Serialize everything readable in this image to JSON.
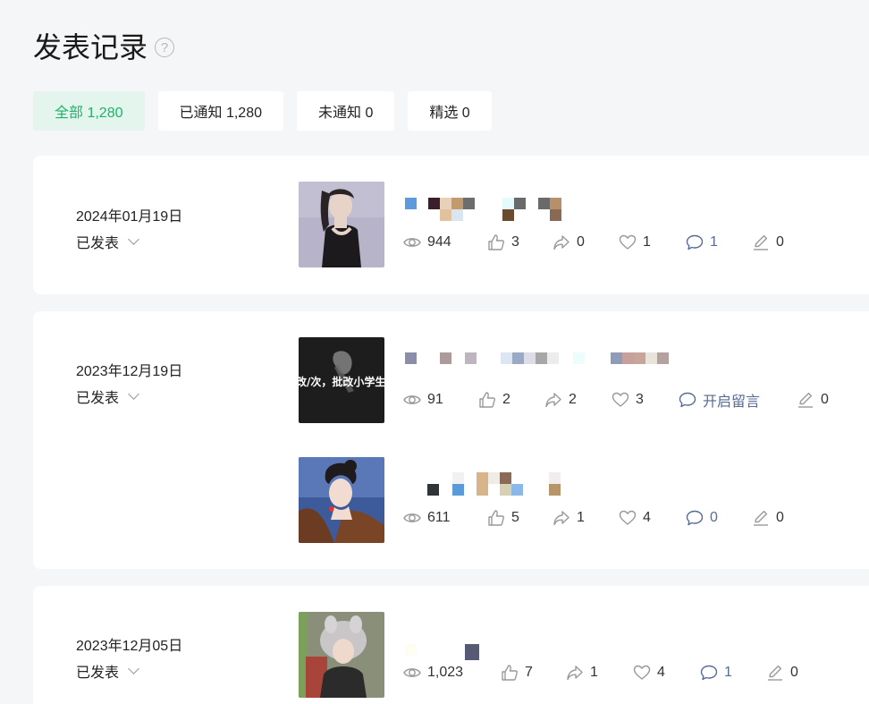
{
  "page_title": "发表记录",
  "filters": [
    {
      "label": "全部 1,280",
      "active": true
    },
    {
      "label": "已通知 1,280",
      "active": false
    },
    {
      "label": "未通知 0",
      "active": false
    },
    {
      "label": "精选 0",
      "active": false
    }
  ],
  "records": [
    {
      "date": "2024年01月19日",
      "status": "已发表",
      "posts": [
        {
          "views": "944",
          "likes": "3",
          "shares": "0",
          "wows": "1",
          "comments": "1",
          "edits": "0"
        }
      ]
    },
    {
      "date": "2023年12月19日",
      "status": "已发表",
      "posts": [
        {
          "thumb_text": "改/次，批改小学生作",
          "views": "91",
          "likes": "2",
          "shares": "2",
          "wows": "3",
          "comments": "开启留言",
          "edits": "0"
        },
        {
          "views": "611",
          "likes": "5",
          "shares": "1",
          "wows": "4",
          "comments": "0",
          "edits": "0"
        }
      ]
    },
    {
      "date": "2023年12月05日",
      "status": "已发表",
      "posts": [
        {
          "views": "1,023",
          "likes": "7",
          "shares": "1",
          "wows": "4",
          "comments": "1",
          "edits": "0"
        }
      ]
    }
  ],
  "colors": {
    "accent": "#1fb26b",
    "accent_bg": "#e3f5ec",
    "link": "#576b95",
    "page_bg": "#f5f6f7"
  }
}
